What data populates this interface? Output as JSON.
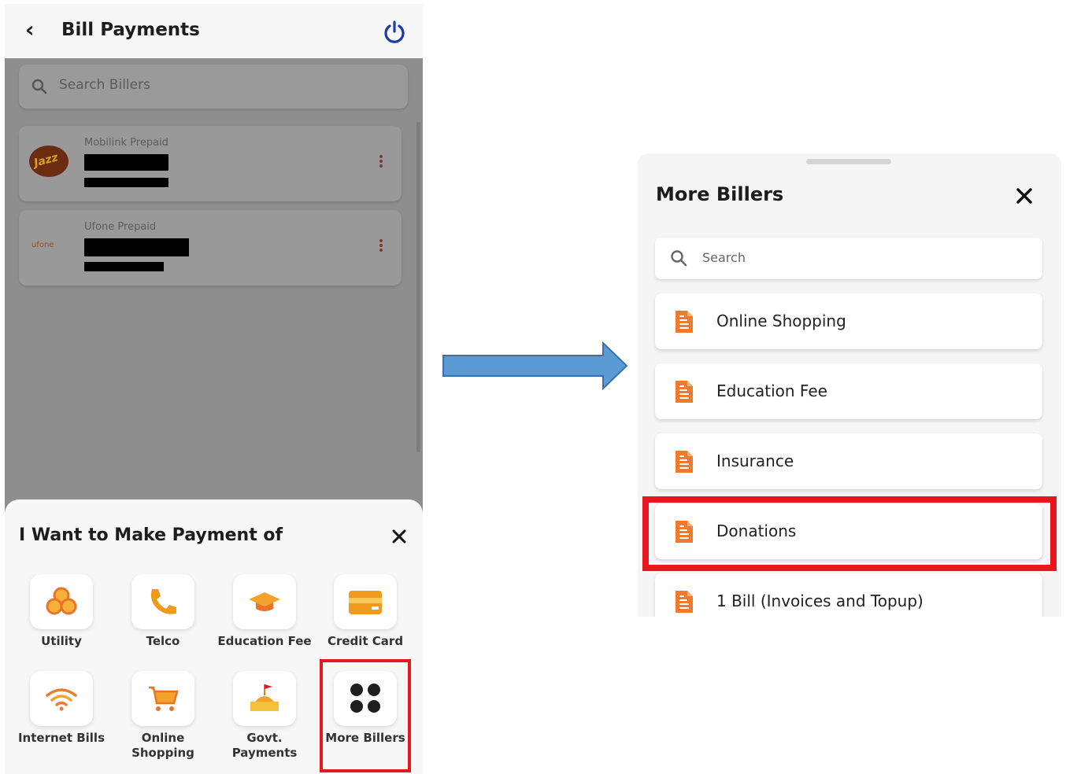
{
  "left_screen": {
    "header": {
      "back_icon": "chevron-left-icon",
      "title": "Bill Payments",
      "power_icon": "power-icon"
    },
    "search": {
      "placeholder": "Search Billers",
      "icon": "search-icon"
    },
    "saved_billers": [
      {
        "name": "Mobilink Prepaid",
        "logo": "jazz-logo",
        "logo_text": "Jazz"
      },
      {
        "name": "Ufone Prepaid",
        "logo": "ufone-logo",
        "logo_text": "ufone"
      }
    ],
    "sheet": {
      "title": "I Want to Make Payment of",
      "close_icon": "close-icon",
      "categories": [
        {
          "label": "Utility",
          "icon": "utility-icon"
        },
        {
          "label": "Telco",
          "icon": "phone-icon"
        },
        {
          "label": "Education Fee",
          "icon": "graduation-cap-icon"
        },
        {
          "label": "Credit Card",
          "icon": "credit-card-icon"
        },
        {
          "label": "Internet Bills",
          "icon": "wifi-icon"
        },
        {
          "label": "Online Shopping",
          "icon": "shopping-cart-icon"
        },
        {
          "label": "Govt. Payments",
          "icon": "government-building-icon"
        },
        {
          "label": "More Billers",
          "icon": "four-dots-icon"
        }
      ]
    }
  },
  "right_screen": {
    "title": "More Billers",
    "close_icon": "close-icon",
    "search": {
      "placeholder": "Search",
      "icon": "search-icon"
    },
    "items": [
      {
        "label": "Online Shopping",
        "icon": "document-icon"
      },
      {
        "label": "Education Fee",
        "icon": "document-icon"
      },
      {
        "label": "Insurance",
        "icon": "document-icon"
      },
      {
        "label": "Donations",
        "icon": "document-icon"
      },
      {
        "label": "1 Bill (Invoices and Topup)",
        "icon": "document-icon"
      }
    ]
  },
  "colors": {
    "accent_orange": "#f07a2e",
    "highlight_red": "#e8161e",
    "arrow_blue": "#5b9bd5",
    "power_blue": "#1c3aa8"
  }
}
